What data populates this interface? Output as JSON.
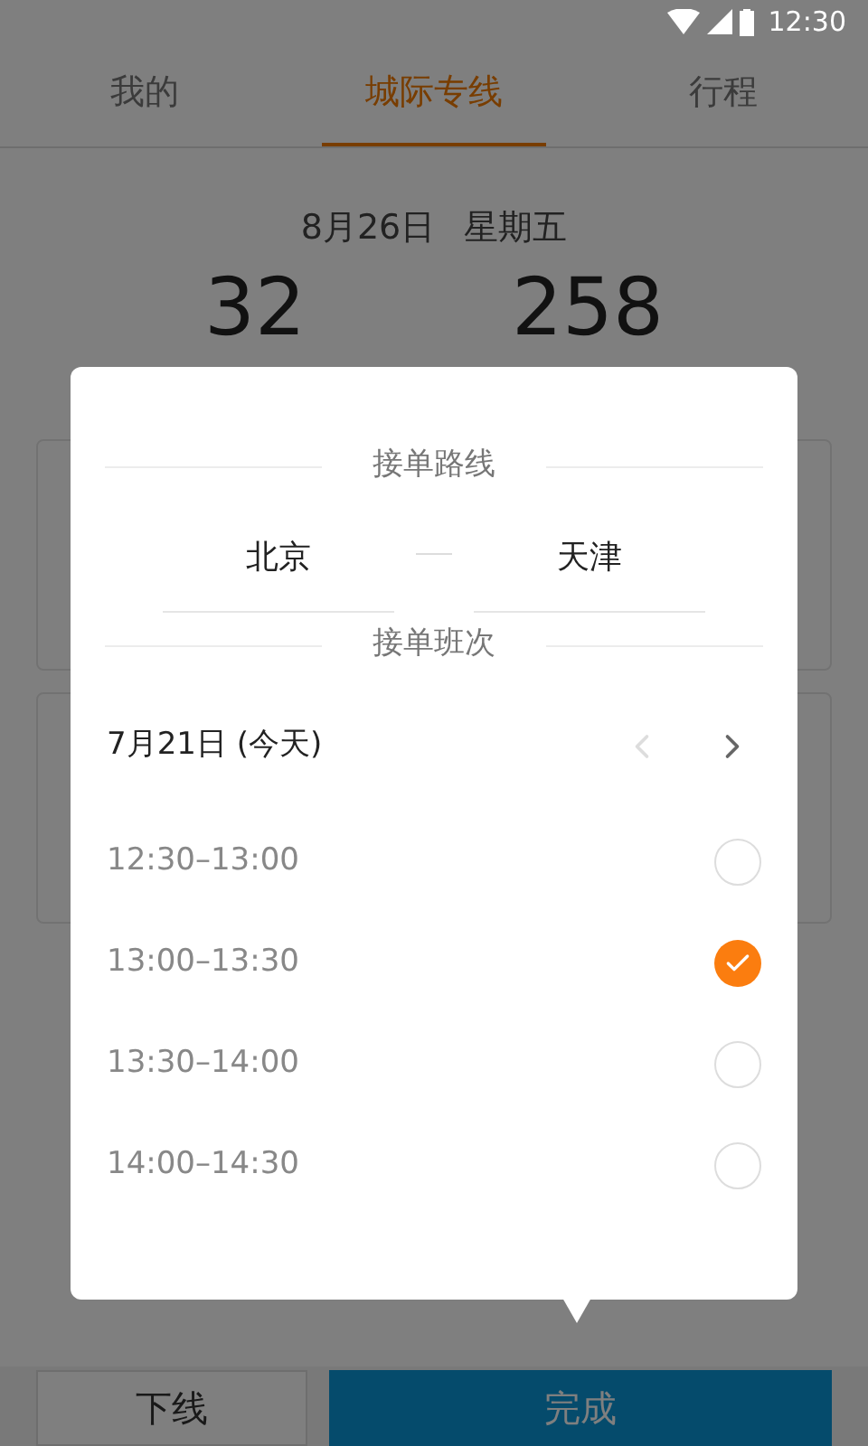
{
  "status_bar": {
    "time": "12:30"
  },
  "tabs": [
    {
      "label": "我的",
      "selected": false
    },
    {
      "label": "城际专线",
      "selected": true
    },
    {
      "label": "行程",
      "selected": false
    }
  ],
  "date": {
    "day": "8月26日",
    "weekday": "星期五"
  },
  "stats": [
    "32",
    "258"
  ],
  "dialog": {
    "route_heading": "接单路线",
    "from": "北京",
    "to": "天津",
    "schedule_heading": "接单班次",
    "day": "7月21日 (今天)",
    "prev_disabled": true,
    "next_disabled": false,
    "slots": [
      {
        "time": "12:30–13:00",
        "selected": false
      },
      {
        "time": "13:00–13:30",
        "selected": true
      },
      {
        "time": "13:30–14:00",
        "selected": false
      },
      {
        "time": "14:00–14:30",
        "selected": false
      }
    ]
  },
  "buttons": [
    {
      "label": "下线",
      "kind": "secondary"
    },
    {
      "label": "完成",
      "kind": "primary"
    }
  ]
}
